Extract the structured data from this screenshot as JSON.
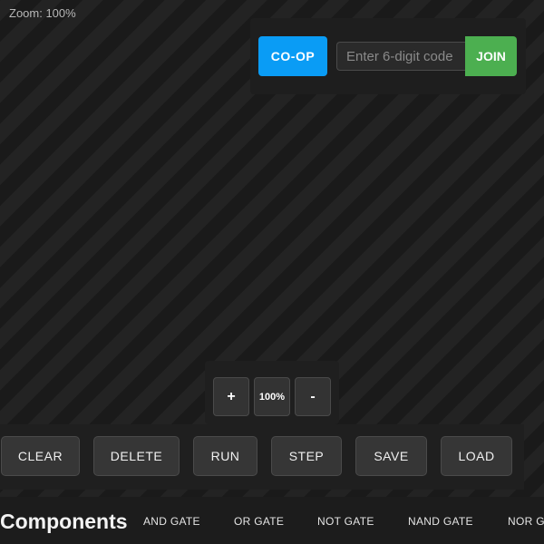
{
  "canvas": {
    "zoom_label": "Zoom: 100%"
  },
  "coop": {
    "coop_label": "CO-OP",
    "code_placeholder": "Enter 6-digit code",
    "code_value": "",
    "join_label": "JOIN"
  },
  "zoom_controls": {
    "zoom_in_label": "+",
    "zoom_level_label": "100%",
    "zoom_out_label": "-"
  },
  "toolbar": {
    "clear_label": "CLEAR",
    "delete_label": "DELETE",
    "run_label": "RUN",
    "step_label": "STEP",
    "save_label": "SAVE",
    "load_label": "LOAD"
  },
  "components": {
    "title": "Components",
    "items": [
      "AND GATE",
      "OR GATE",
      "NOT GATE",
      "NAND GATE",
      "NOR GATE"
    ]
  },
  "colors": {
    "coop_button": "#0a9cf5",
    "join_button": "#4caf50",
    "panel_background": "#1f1f1f"
  }
}
